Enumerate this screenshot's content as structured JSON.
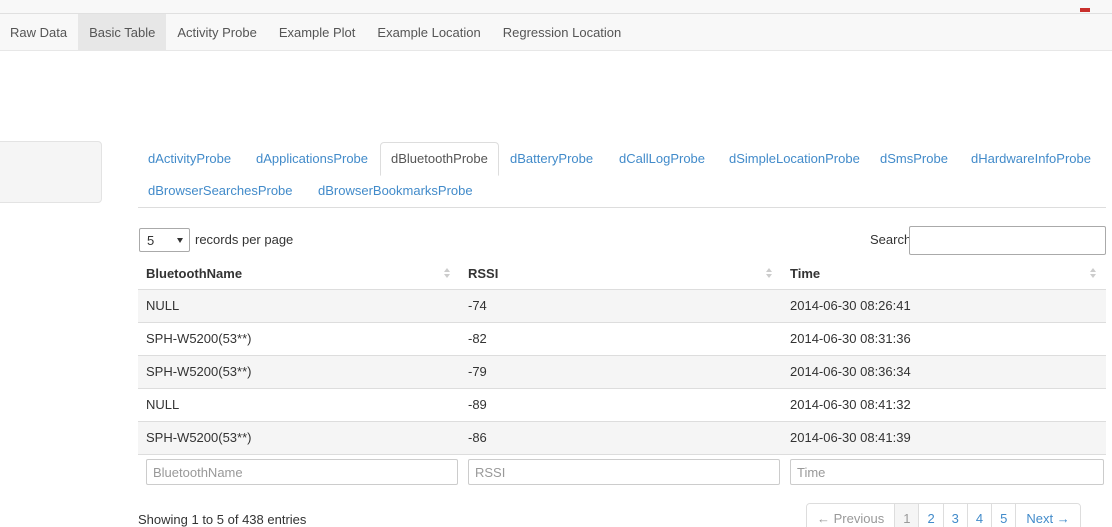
{
  "nav": {
    "items": [
      {
        "label": "Raw Data",
        "active": false
      },
      {
        "label": "Basic Table",
        "active": true
      },
      {
        "label": "Activity Probe",
        "active": false
      },
      {
        "label": "Example Plot",
        "active": false
      },
      {
        "label": "Example Location",
        "active": false
      },
      {
        "label": "Regression Location",
        "active": false
      }
    ]
  },
  "probe_tabs": [
    {
      "label": "dActivityProbe",
      "active": false
    },
    {
      "label": "dApplicationsProbe",
      "active": false
    },
    {
      "label": "dBluetoothProbe",
      "active": true
    },
    {
      "label": "dBatteryProbe",
      "active": false
    },
    {
      "label": "dCallLogProbe",
      "active": false
    },
    {
      "label": "dSimpleLocationProbe",
      "active": false
    },
    {
      "label": "dSmsProbe",
      "active": false
    },
    {
      "label": "dHardwareInfoProbe",
      "active": false
    },
    {
      "label": "dBrowserSearchesProbe",
      "active": false
    },
    {
      "label": "dBrowserBookmarksProbe",
      "active": false
    }
  ],
  "length": {
    "selected": "5",
    "label": "records per page"
  },
  "search": {
    "label": "Search:",
    "value": ""
  },
  "table": {
    "columns": [
      "BluetoothName",
      "RSSI",
      "Time"
    ],
    "rows": [
      [
        "NULL",
        "-74",
        "2014-06-30 08:26:41"
      ],
      [
        "SPH-W5200(53**)",
        "-82",
        "2014-06-30 08:31:36"
      ],
      [
        "SPH-W5200(53**)",
        "-79",
        "2014-06-30 08:36:34"
      ],
      [
        "NULL",
        "-89",
        "2014-06-30 08:41:32"
      ],
      [
        "SPH-W5200(53**)",
        "-86",
        "2014-06-30 08:41:39"
      ]
    ],
    "filters": [
      "BluetoothName",
      "RSSI",
      "Time"
    ]
  },
  "info": "Showing 1 to 5 of 438 entries",
  "pagination": {
    "previous": "← Previous",
    "pages": [
      "1",
      "2",
      "3",
      "4",
      "5"
    ],
    "current": "1",
    "next": "Next →"
  },
  "colors": {
    "link": "#428bca",
    "stripe": "#f5f5f5",
    "navbar": "#f8f8f8"
  }
}
